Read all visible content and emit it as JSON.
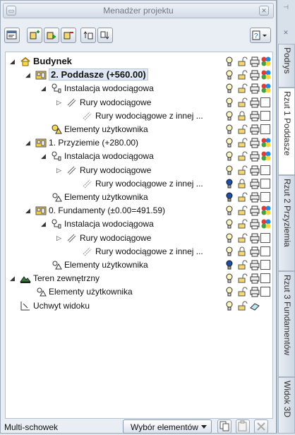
{
  "window": {
    "title": "Menadżer projektu"
  },
  "tree": [
    {
      "label": "Budynek",
      "bold": true,
      "sel": false,
      "exp": "open",
      "icon": "building-icon",
      "indent": 0,
      "status": [
        "bulb",
        "lock",
        "printer",
        "color"
      ]
    },
    {
      "label": "2. Poddasze (+560.00)",
      "bold": true,
      "sel": true,
      "exp": "open",
      "icon": "storey-icon",
      "indent": 1,
      "status": [
        "bulb",
        "lock",
        "printer",
        "color"
      ]
    },
    {
      "label": "Instalacja wodociągowa",
      "bold": false,
      "sel": false,
      "exp": "open",
      "icon": "installation-icon",
      "indent": 2,
      "status": [
        "bulb",
        "lock",
        "printer",
        "color"
      ]
    },
    {
      "label": "Rury wodociągowe",
      "bold": false,
      "sel": false,
      "exp": "closed",
      "icon": "pipe-icon",
      "indent": 3,
      "status": [
        "bulb",
        "lock",
        "printer",
        "empty"
      ]
    },
    {
      "label": "Rury wodociągowe z innej ...",
      "bold": false,
      "sel": false,
      "exp": "",
      "icon": "pipe-ref-icon",
      "indent": 4,
      "status": [
        "bulb",
        "lock-closed",
        "printer",
        "empty"
      ]
    },
    {
      "label": "Elementy użytkownika",
      "bold": false,
      "sel": false,
      "exp": "",
      "icon": "user-elements-active-icon",
      "indent": 2,
      "status": [
        "bulb",
        "lock",
        "printer",
        "empty"
      ]
    },
    {
      "label": "1. Przyziemie (+280.00)",
      "bold": false,
      "sel": false,
      "exp": "open",
      "icon": "storey-icon",
      "indent": 1,
      "status": [
        "bulb",
        "lock",
        "printer",
        "color"
      ]
    },
    {
      "label": "Instalacja wodociągowa",
      "bold": false,
      "sel": false,
      "exp": "open",
      "icon": "installation-icon",
      "indent": 2,
      "status": [
        "bulb",
        "lock",
        "printer",
        "color"
      ]
    },
    {
      "label": "Rury wodociągowe",
      "bold": false,
      "sel": false,
      "exp": "closed",
      "icon": "pipe-icon",
      "indent": 3,
      "status": [
        "bulb",
        "lock",
        "printer",
        "empty"
      ]
    },
    {
      "label": "Rury wodociągowe z innej ...",
      "bold": false,
      "sel": false,
      "exp": "",
      "icon": "pipe-ref-icon",
      "indent": 4,
      "status": [
        "bulb-off",
        "lock-closed",
        "printer",
        "empty"
      ]
    },
    {
      "label": "Elementy użytkownika",
      "bold": false,
      "sel": false,
      "exp": "",
      "icon": "user-elements-icon",
      "indent": 2,
      "status": [
        "bulb-off",
        "lock",
        "printer",
        "empty"
      ]
    },
    {
      "label": "0. Fundamenty (±0.00=491.59)",
      "bold": false,
      "sel": false,
      "exp": "open",
      "icon": "storey-icon",
      "indent": 1,
      "status": [
        "bulb",
        "lock",
        "printer",
        "color"
      ]
    },
    {
      "label": "Instalacja wodociągowa",
      "bold": false,
      "sel": false,
      "exp": "open",
      "icon": "installation-icon",
      "indent": 2,
      "status": [
        "bulb",
        "lock",
        "printer",
        "color"
      ]
    },
    {
      "label": "Rury wodociągowe",
      "bold": false,
      "sel": false,
      "exp": "closed",
      "icon": "pipe-icon",
      "indent": 3,
      "status": [
        "bulb",
        "lock",
        "printer",
        "empty"
      ]
    },
    {
      "label": "Rury wodociągowe z innej ...",
      "bold": false,
      "sel": false,
      "exp": "",
      "icon": "pipe-ref-icon",
      "indent": 4,
      "status": [
        "bulb",
        "lock-closed",
        "printer",
        "empty"
      ]
    },
    {
      "label": "Elementy użytkownika",
      "bold": false,
      "sel": false,
      "exp": "",
      "icon": "user-elements-icon",
      "indent": 2,
      "status": [
        "bulb-off",
        "lock",
        "printer",
        "empty"
      ]
    },
    {
      "label": "Teren zewnętrzny",
      "bold": false,
      "sel": false,
      "exp": "open",
      "icon": "terrain-icon",
      "indent": 0,
      "status": [
        "bulb",
        "lock",
        "printer",
        "empty"
      ]
    },
    {
      "label": "Elementy użytkownika",
      "bold": false,
      "sel": false,
      "exp": "",
      "icon": "user-elements-icon",
      "indent": 1,
      "status": [
        "bulb",
        "lock",
        "printer",
        "empty"
      ]
    },
    {
      "label": "Uchwyt widoku",
      "bold": false,
      "sel": false,
      "exp": "",
      "icon": "view-handle-icon",
      "indent": 0,
      "status": [
        "bulb",
        "lock",
        "eraser"
      ]
    }
  ],
  "bottom": {
    "label": "Multi-schowek",
    "combo": "Wybór elementów"
  },
  "tabs": [
    "Podrys",
    "Rzut 1 Poddasze",
    "Rzut 2 Przyziemia",
    "Rzut 3 Fundamentów",
    "Widok 3D"
  ]
}
